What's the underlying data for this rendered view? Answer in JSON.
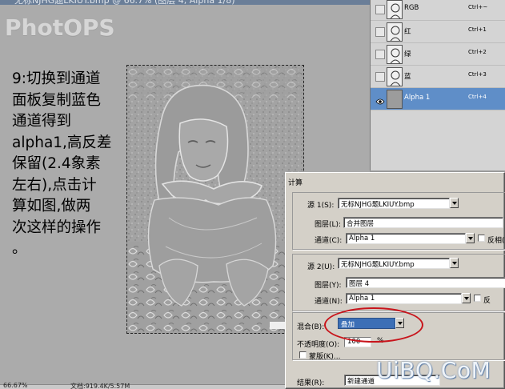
{
  "document": {
    "title": "无标NJHG题LKIUY.bmp @ 66.7% (图层 4, Alpha 1/8)",
    "watermark": "PhotOPS",
    "zoom": "66.67%",
    "doc_size": "文档:919.4K/5.57M"
  },
  "tutorial_lines": [
    "9:切换到通道",
    "面板复制蓝色",
    "通道得到",
    "alpha1,高反差",
    "保留(2.4象素",
    "左右),点击计",
    "算如图,做两",
    "次这样的操作",
    "。"
  ],
  "channels": [
    {
      "name": "RGB",
      "shortcut": "Ctrl+~",
      "visible": false,
      "active": false
    },
    {
      "name": "红",
      "shortcut": "Ctrl+1",
      "visible": false,
      "active": false
    },
    {
      "name": "绿",
      "shortcut": "Ctrl+2",
      "visible": false,
      "active": false
    },
    {
      "name": "蓝",
      "shortcut": "Ctrl+3",
      "visible": false,
      "active": false
    },
    {
      "name": "Alpha 1",
      "shortcut": "Ctrl+4",
      "visible": true,
      "active": true
    }
  ],
  "dialog": {
    "title": "计算",
    "source1": {
      "label": "源 1(S):",
      "file": "无标NJHG题LKIUY.bmp",
      "layer_label": "图层(L):",
      "layer": "合并图层",
      "channel_label": "通道(C):",
      "channel": "Alpha 1",
      "invert_label": "反相("
    },
    "source2": {
      "label": "源 2(U):",
      "file": "无标NJHG题LKIUY.bmp",
      "layer_label": "图层(Y):",
      "layer": "图层 4",
      "channel_label": "通道(N):",
      "channel": "Alpha 1",
      "invert_label": "反"
    },
    "blending": {
      "label": "混合(B):",
      "mode": "叠加",
      "opacity_label": "不透明度(O):",
      "opacity": "100",
      "opacity_unit": "%",
      "mask_label": "蒙版(K)..."
    },
    "result": {
      "label": "结果(R):",
      "value": "新建通道"
    }
  },
  "site_watermark": "UiBQ.CoM",
  "colors": {
    "panel_bg": "#d4d4d4",
    "active_row": "#5f8ec8",
    "dialog_bg": "#d4d0c8",
    "highlight_circle": "#c8141b"
  }
}
